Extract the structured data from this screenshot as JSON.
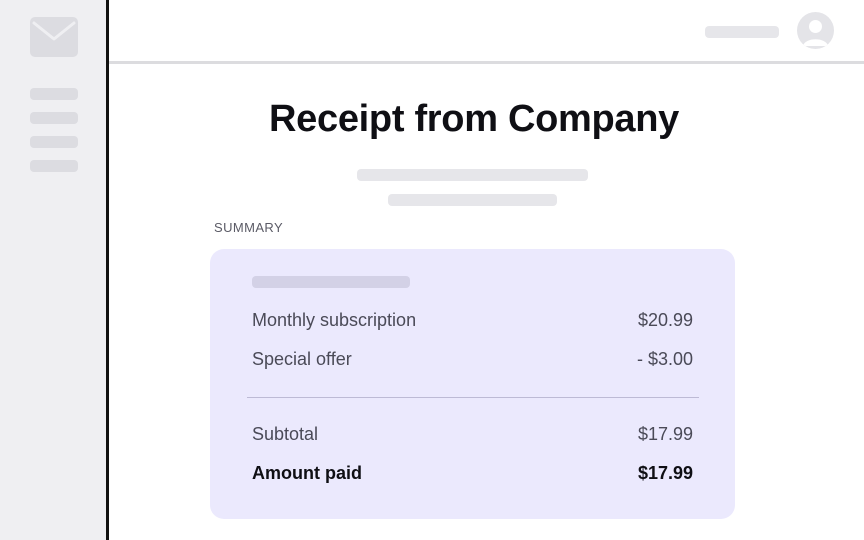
{
  "sidebar": {
    "icon": "mail-icon",
    "nav_items": [
      "",
      "",
      "",
      ""
    ]
  },
  "header": {
    "avatar_icon": "user-avatar-icon"
  },
  "main": {
    "title": "Receipt from Company",
    "summary_label": "SUMMARY"
  },
  "summary": {
    "items": [
      {
        "label": "Monthly subscription",
        "amount": "$20.99"
      },
      {
        "label": "Special offer",
        "amount": "- $3.00"
      }
    ],
    "subtotal": {
      "label": "Subtotal",
      "amount": "$17.99"
    },
    "total": {
      "label": "Amount paid",
      "amount": "$17.99"
    }
  },
  "colors": {
    "sidebar_bg": "#efeff2",
    "card_bg": "#ebe9fd",
    "title": "#0f0f14",
    "muted_text": "#4a4a57",
    "placeholder": "#e6e6ea"
  }
}
